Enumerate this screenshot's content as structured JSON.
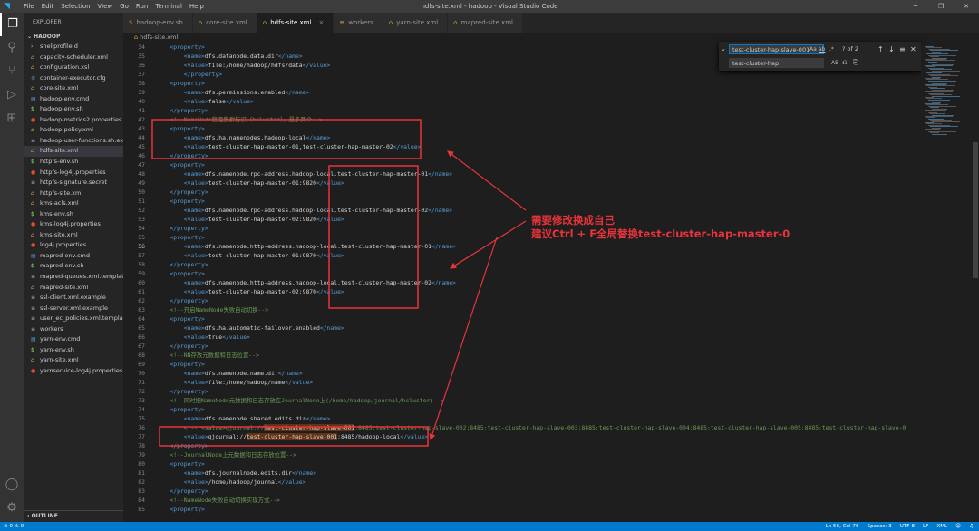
{
  "window": {
    "title": "hdfs-site.xml - hadoop - Visual Studio Code",
    "menu": [
      "File",
      "Edit",
      "Selection",
      "View",
      "Go",
      "Run",
      "Terminal",
      "Help"
    ]
  },
  "explorer": {
    "header": "EXPLORER",
    "root": "HADOOP",
    "outline": "OUTLINE",
    "files": [
      {
        "name": "shellprofile.d",
        "type": "folder"
      },
      {
        "name": "capacity-scheduler.xml",
        "type": "xml"
      },
      {
        "name": "configuration.xsl",
        "type": "xsl"
      },
      {
        "name": "container-executor.cfg",
        "type": "cfg"
      },
      {
        "name": "core-site.xml",
        "type": "xml"
      },
      {
        "name": "hadoop-env.cmd",
        "type": "cmd"
      },
      {
        "name": "hadoop-env.sh",
        "type": "sh"
      },
      {
        "name": "hadoop-metrics2.properties",
        "type": "props"
      },
      {
        "name": "hadoop-policy.xml",
        "type": "xml"
      },
      {
        "name": "hadoop-user-functions.sh.ex...",
        "type": "file"
      },
      {
        "name": "hdfs-site.xml",
        "type": "xml",
        "selected": true
      },
      {
        "name": "httpfs-env.sh",
        "type": "sh"
      },
      {
        "name": "httpfs-log4j.properties",
        "type": "props"
      },
      {
        "name": "httpfs-signature.secret",
        "type": "file"
      },
      {
        "name": "httpfs-site.xml",
        "type": "xml"
      },
      {
        "name": "kms-acls.xml",
        "type": "xml"
      },
      {
        "name": "kms-env.sh",
        "type": "sh"
      },
      {
        "name": "kms-log4j.properties",
        "type": "props"
      },
      {
        "name": "kms-site.xml",
        "type": "xml"
      },
      {
        "name": "log4j.properties",
        "type": "props"
      },
      {
        "name": "mapred-env.cmd",
        "type": "cmd"
      },
      {
        "name": "mapred-env.sh",
        "type": "sh"
      },
      {
        "name": "mapred-queues.xml.template",
        "type": "file"
      },
      {
        "name": "mapred-site.xml",
        "type": "xml"
      },
      {
        "name": "ssl-client.xml.example",
        "type": "file"
      },
      {
        "name": "ssl-server.xml.example",
        "type": "file"
      },
      {
        "name": "user_ec_policies.xml.template",
        "type": "file"
      },
      {
        "name": "workers",
        "type": "file"
      },
      {
        "name": "yarn-env.cmd",
        "type": "cmd"
      },
      {
        "name": "yarn-env.sh",
        "type": "sh"
      },
      {
        "name": "yarn-site.xml",
        "type": "xml"
      },
      {
        "name": "yarnservice-log4j.properties",
        "type": "props"
      }
    ]
  },
  "tabs": [
    {
      "label": "hadoop-env.sh",
      "icon": "$",
      "active": false
    },
    {
      "label": "core-site.xml",
      "icon": "⌂",
      "active": false
    },
    {
      "label": "hdfs-site.xml",
      "icon": "⌂",
      "active": true
    },
    {
      "label": "workers",
      "icon": "≡",
      "active": false
    },
    {
      "label": "yarn-site.xml",
      "icon": "⌂",
      "active": false
    },
    {
      "label": "mapred-site.xml",
      "icon": "⌂",
      "active": false
    }
  ],
  "breadcrumb": "hdfs-site.xml",
  "find": {
    "search": "test-cluster-hap-slave-001",
    "replace": "test-cluster-hap",
    "count": "? of 2",
    "aa": "Aa",
    "ab": "ab",
    "regex": ".*",
    "preserve": "AB"
  },
  "annotation": {
    "line1": "需要修改换成自己",
    "line2": "建议Ctrl + F全局替换test-cluster-hap-master-0"
  },
  "lines": [
    {
      "n": "34",
      "s": [
        [
          "t",
          "    <property>"
        ]
      ]
    },
    {
      "n": "35",
      "s": [
        [
          "t",
          "        <name>"
        ],
        [
          "x",
          "dfs.datanode.data.dir"
        ],
        [
          "t",
          "</name>"
        ]
      ]
    },
    {
      "n": "36",
      "s": [
        [
          "t",
          "        <value>"
        ],
        [
          "x",
          "file:/home/hadoop/hdfs/data"
        ],
        [
          "t",
          "</value>"
        ]
      ]
    },
    {
      "n": "37",
      "s": [
        [
          "t",
          "        </property>"
        ]
      ]
    },
    {
      "n": "38",
      "s": [
        [
          "t",
          "    <property>"
        ]
      ]
    },
    {
      "n": "39",
      "s": [
        [
          "t",
          "        <name>"
        ],
        [
          "x",
          "dfs.permissions.enabled"
        ],
        [
          "t",
          "</name>"
        ]
      ]
    },
    {
      "n": "40",
      "s": [
        [
          "t",
          "        <value>"
        ],
        [
          "x",
          "false"
        ],
        [
          "t",
          "</value>"
        ]
      ]
    },
    {
      "n": "41",
      "s": [
        [
          "t",
          "    </property>"
        ]
      ]
    },
    {
      "n": "42",
      "s": [
        [
          "c",
          "    <!--NameNode稳定集群标识（hcluster），最多两个-->"
        ]
      ]
    },
    {
      "n": "43",
      "s": [
        [
          "t",
          "    <property>"
        ]
      ]
    },
    {
      "n": "44",
      "s": [
        [
          "t",
          "        <name>"
        ],
        [
          "x",
          "dfs.ha.namenodes.hadoop-local"
        ],
        [
          "t",
          "</name>"
        ]
      ]
    },
    {
      "n": "45",
      "s": [
        [
          "t",
          "        <value>"
        ],
        [
          "x",
          "test-cluster-hap-master-01,test-cluster-hap-master-02"
        ],
        [
          "t",
          "</value>"
        ]
      ]
    },
    {
      "n": "46",
      "s": [
        [
          "t",
          "    </property>"
        ]
      ]
    },
    {
      "n": "47",
      "s": [
        [
          "t",
          "    <property>"
        ]
      ]
    },
    {
      "n": "48",
      "s": [
        [
          "t",
          "        <name>"
        ],
        [
          "x",
          "dfs.namenode.rpc-address.hadoop-local.test-cluster-hap-master-01"
        ],
        [
          "t",
          "</name>"
        ]
      ]
    },
    {
      "n": "49",
      "s": [
        [
          "t",
          "        <value>"
        ],
        [
          "x",
          "test-cluster-hap-master-01:9820"
        ],
        [
          "t",
          "</value>"
        ]
      ]
    },
    {
      "n": "50",
      "s": [
        [
          "t",
          "    </property>"
        ]
      ]
    },
    {
      "n": "51",
      "s": [
        [
          "t",
          "    <property>"
        ]
      ]
    },
    {
      "n": "52",
      "s": [
        [
          "t",
          "        <name>"
        ],
        [
          "x",
          "dfs.namenode.rpc-address.hadoop-local.test-cluster-hap-master-02"
        ],
        [
          "t",
          "</name>"
        ]
      ]
    },
    {
      "n": "53",
      "s": [
        [
          "t",
          "        <value>"
        ],
        [
          "x",
          "test-cluster-hap-master-02:9820"
        ],
        [
          "t",
          "</value>"
        ]
      ]
    },
    {
      "n": "54",
      "s": [
        [
          "t",
          "    </property>"
        ]
      ]
    },
    {
      "n": "55",
      "s": [
        [
          "t",
          "    <property>"
        ]
      ]
    },
    {
      "n": "56",
      "s": [
        [
          "t",
          "        <name>"
        ],
        [
          "x",
          "dfs.namenode.http-address.hadoop-local.test-cluster-hap-master-01"
        ],
        [
          "t",
          "</name>"
        ]
      ],
      "cur": true
    },
    {
      "n": "57",
      "s": [
        [
          "t",
          "        <value>"
        ],
        [
          "x",
          "test-cluster-hap-master-01:9870"
        ],
        [
          "t",
          "</value>"
        ]
      ]
    },
    {
      "n": "58",
      "s": [
        [
          "t",
          "    </property>"
        ]
      ]
    },
    {
      "n": "59",
      "s": [
        [
          "t",
          "    <property>"
        ]
      ]
    },
    {
      "n": "60",
      "s": [
        [
          "t",
          "        <name>"
        ],
        [
          "x",
          "dfs.namenode.http-address.hadoop-local.test-cluster-hap-master-02"
        ],
        [
          "t",
          "</name>"
        ]
      ]
    },
    {
      "n": "61",
      "s": [
        [
          "t",
          "        <value>"
        ],
        [
          "x",
          "test-cluster-hap-master-02:9870"
        ],
        [
          "t",
          "</value>"
        ]
      ]
    },
    {
      "n": "62",
      "s": [
        [
          "t",
          "    </property>"
        ]
      ]
    },
    {
      "n": "63",
      "s": [
        [
          "c",
          "    <!--开启NameNode失败自动切换-->"
        ]
      ]
    },
    {
      "n": "64",
      "s": [
        [
          "t",
          "    <property>"
        ]
      ]
    },
    {
      "n": "65",
      "s": [
        [
          "t",
          "        <name>"
        ],
        [
          "x",
          "dfs.ha.automatic-failover.enabled"
        ],
        [
          "t",
          "</name>"
        ]
      ]
    },
    {
      "n": "66",
      "s": [
        [
          "t",
          "        <value>"
        ],
        [
          "x",
          "true"
        ],
        [
          "t",
          "</value>"
        ]
      ]
    },
    {
      "n": "67",
      "s": [
        [
          "t",
          "    </property>"
        ]
      ]
    },
    {
      "n": "68",
      "s": [
        [
          "c",
          "    <!--NN存放元数据和日志位置-->"
        ]
      ]
    },
    {
      "n": "69",
      "s": [
        [
          "t",
          "    <property>"
        ]
      ]
    },
    {
      "n": "70",
      "s": [
        [
          "t",
          "        <name>"
        ],
        [
          "x",
          "dfs.namenode.name.dir"
        ],
        [
          "t",
          "</name>"
        ]
      ]
    },
    {
      "n": "71",
      "s": [
        [
          "t",
          "        <value>"
        ],
        [
          "x",
          "file:/home/hadoop/name"
        ],
        [
          "t",
          "</value>"
        ]
      ]
    },
    {
      "n": "72",
      "s": [
        [
          "t",
          "    </property>"
        ]
      ]
    },
    {
      "n": "73",
      "s": [
        [
          "c",
          "    <!--同时把NameNode元数据和日志存放在JournalNode上(/home/hadoop/journal/hcluster)-->"
        ]
      ]
    },
    {
      "n": "74",
      "s": [
        [
          "t",
          "    <property>"
        ]
      ]
    },
    {
      "n": "75",
      "s": [
        [
          "t",
          "        <name>"
        ],
        [
          "x",
          "dfs.namenode.shared.edits.dir"
        ],
        [
          "t",
          "</name>"
        ]
      ]
    },
    {
      "n": "76",
      "s": [
        [
          "c",
          "        <!-- <value>qjournal://"
        ],
        [
          "h",
          "test-cluster-hap-slave-001"
        ],
        [
          "c",
          ":8485;test-cluster-hap-slave-002:8485;test-cluster-hap-slave-003:8485;test-cluster-hap-slave-004:8485;test-cluster-hap-slave-005:8485;test-cluster-hap-slave-0"
        ]
      ]
    },
    {
      "n": "77",
      "s": [
        [
          "t",
          "        <value>"
        ],
        [
          "x",
          "qjournal://"
        ],
        [
          "h",
          "test-cluster-hap-slave-001"
        ],
        [
          "x",
          ":8485/hadoop-local"
        ],
        [
          "t",
          "</value>"
        ]
      ]
    },
    {
      "n": "78",
      "s": [
        [
          "t",
          "    </property>"
        ]
      ]
    },
    {
      "n": "79",
      "s": [
        [
          "c",
          "    <!--JournalNode上元数据和日志存放位置-->"
        ]
      ]
    },
    {
      "n": "80",
      "s": [
        [
          "t",
          "    <property>"
        ]
      ]
    },
    {
      "n": "81",
      "s": [
        [
          "t",
          "        <name>"
        ],
        [
          "x",
          "dfs.journalnode.edits.dir"
        ],
        [
          "t",
          "</name>"
        ]
      ]
    },
    {
      "n": "82",
      "s": [
        [
          "t",
          "        <value>"
        ],
        [
          "x",
          "/home/hadoop/journal"
        ],
        [
          "t",
          "</value>"
        ]
      ]
    },
    {
      "n": "83",
      "s": [
        [
          "t",
          "    </property>"
        ]
      ]
    },
    {
      "n": "84",
      "s": [
        [
          "c",
          "    <!--NameNode失败自动切换实现方式-->"
        ]
      ]
    },
    {
      "n": "85",
      "s": [
        [
          "t",
          "    <property>"
        ]
      ]
    },
    {
      "n": "86",
      "s": [
        [
          "t",
          "        <name>"
        ],
        [
          "x",
          "dfs.client.failover.proxy.provider.hadoop-local"
        ],
        [
          "t",
          "</name>"
        ]
      ]
    }
  ],
  "status": {
    "left": "⊗ 0  ⚠ 0",
    "position": "Ln 56, Col 76",
    "spaces": "Spaces: 3",
    "encoding": "UTF-8",
    "eol": "LF",
    "lang": "XML"
  }
}
